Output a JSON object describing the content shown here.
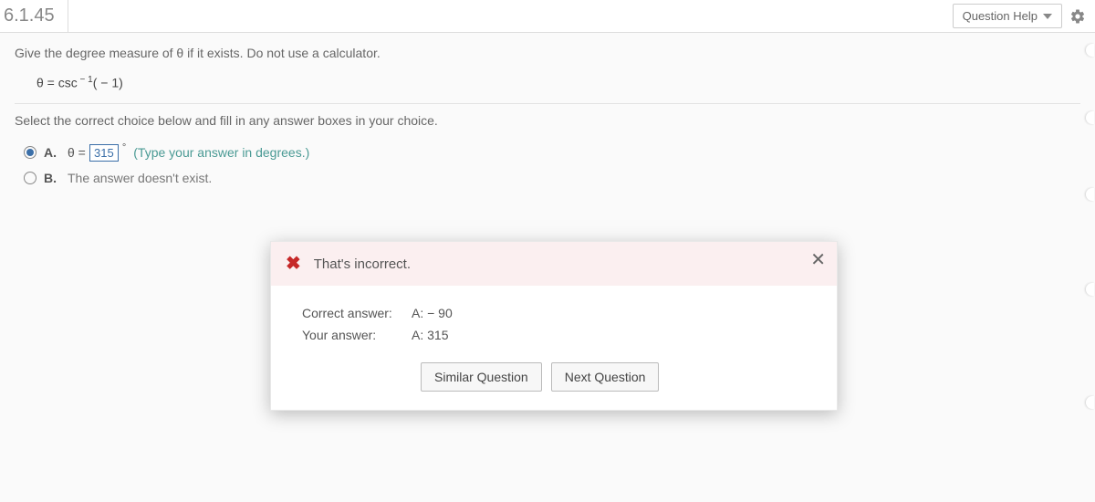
{
  "header": {
    "question_number": "6.1.45",
    "help_label": "Question Help"
  },
  "prompt": "Give the degree measure of θ if it exists. Do not use a calculator.",
  "equation": {
    "lhs": "θ = csc",
    "sup": " − 1",
    "arg": "( − 1)"
  },
  "select_prompt": "Select the correct choice below and fill in any answer boxes in your choice.",
  "choices": {
    "a": {
      "letter": "A.",
      "prefix": "θ = ",
      "input_value": "315",
      "suffix": "°",
      "hint": "(Type your answer in degrees.)"
    },
    "b": {
      "letter": "B.",
      "text": "The answer doesn't exist."
    }
  },
  "feedback": {
    "title": "That's incorrect.",
    "correct_label": "Correct answer:",
    "correct_value": "A:  − 90",
    "your_label": "Your answer:",
    "your_value": "A: 315",
    "similar_btn": "Similar Question",
    "next_btn": "Next Question"
  }
}
